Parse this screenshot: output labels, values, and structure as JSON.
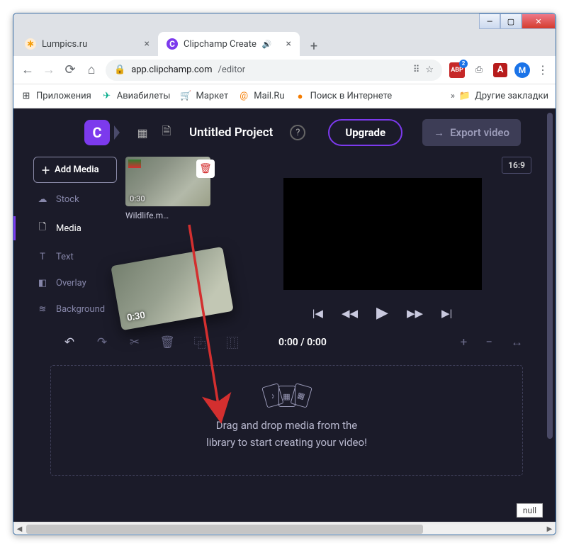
{
  "window": {
    "min": "—",
    "max": "▢",
    "close": "✕"
  },
  "browser": {
    "tabs": [
      {
        "favicon": "✱",
        "title": "Lumpics.ru",
        "active": false,
        "audio": false
      },
      {
        "favicon": "C",
        "title": "Clipchamp Create",
        "active": true,
        "audio": true
      }
    ],
    "newtab": "+",
    "nav": {
      "back": "←",
      "fwd": "→",
      "reload": "⟳",
      "home": "⌂"
    },
    "address": {
      "lock": "🔒",
      "host": "app.clipchamp.com",
      "path": "/editor",
      "translate": "⠿",
      "star": "☆"
    },
    "ext": {
      "abp": "ABP",
      "screen": "⎙",
      "pdf": "A",
      "m": "M"
    },
    "kebab": "⋮",
    "bookmarks": {
      "apps": "Приложения",
      "avia": "Авиабилеты",
      "market": "Маркет",
      "mail": "Mail.Ru",
      "search": "Поиск в Интернете",
      "chev": "»",
      "other": "Другие закладки"
    }
  },
  "app": {
    "logo": "C",
    "topbar": {
      "tmpl": "▦",
      "file": "🗎",
      "title": "Untitled Project",
      "help": "?",
      "upgrade": "Upgrade",
      "export": "Export video",
      "export_arrow": "→"
    },
    "side": {
      "add": "Add Media",
      "stock": "Stock",
      "media": "Media",
      "text": "Text",
      "overlay": "Overlay",
      "background": "Background"
    },
    "media": {
      "duration": "0:30",
      "filename": "Wildlife.m…",
      "delete": "🗑"
    },
    "drag": {
      "duration": "0:30"
    },
    "aspect": "16:9",
    "player": {
      "prev": "|◀",
      "rw": "◀◀",
      "play": "▶",
      "ff": "▶▶",
      "next": "▶|"
    },
    "tools": {
      "undo": "↶",
      "redo": "↷",
      "cut": "✂",
      "del": "🗑",
      "copy": "⿻",
      "split": "⿲",
      "time": "0:00 / 0:00",
      "zin": "+",
      "zout": "−",
      "fit": "↔"
    },
    "drop": {
      "card1": "♪",
      "card2": "▦",
      "card3": "▦",
      "line1": "Drag and drop media from the",
      "line2": "library to start creating your video!"
    },
    "null": "null"
  }
}
